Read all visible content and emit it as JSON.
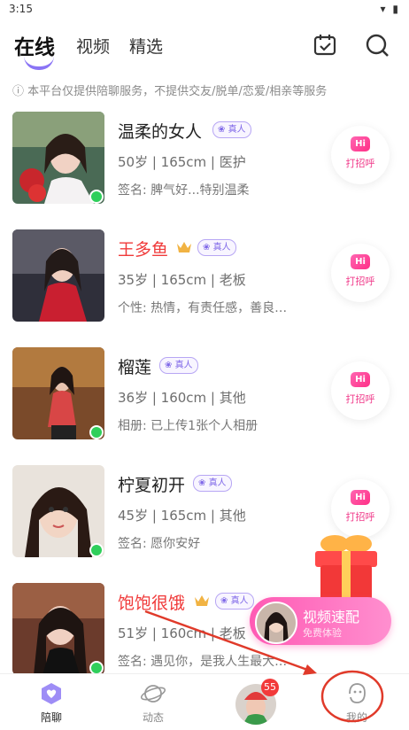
{
  "status": {
    "time": "3:15",
    "icons": "▾ ▮"
  },
  "topnav": {
    "tabs": [
      {
        "label": "在线",
        "active": true
      },
      {
        "label": "视频",
        "active": false
      },
      {
        "label": "精选",
        "active": false
      }
    ],
    "actions": [
      "calendar-check-icon",
      "search-icon"
    ]
  },
  "notice": "ⓘ 本平台仅提供陪聊服务，不提供交友/脱单/恋爱/相亲等服务",
  "real_badge": "真人",
  "greet_label": "打招呼",
  "greet_hi": "Hi",
  "users": [
    {
      "name": "温柔的女人",
      "vip": false,
      "info": "50岁 | 165cm | 医护",
      "sig": "签名: 脾气好...特别温柔",
      "online": true
    },
    {
      "name": "王多鱼",
      "vip": true,
      "info": "35岁 | 165cm | 老板",
      "sig": "个性: 热情，有责任感，善良…",
      "online": false
    },
    {
      "name": "榴莲",
      "vip": false,
      "info": "36岁 | 160cm | 其他",
      "sig": "相册: 已上传1张个人相册",
      "online": true
    },
    {
      "name": "柠夏初开",
      "vip": false,
      "info": "45岁 | 165cm | 其他",
      "sig": "签名: 愿你安好",
      "online": true
    },
    {
      "name": "饱饱很饿",
      "vip": true,
      "info": "51岁 | 160cm | 老板",
      "sig": "签名: 遇见你，是我人生最大…",
      "online": true
    }
  ],
  "match_promo": {
    "title": "视频速配",
    "subtitle": "免费体验"
  },
  "tabbar": {
    "items": [
      {
        "label": "陪聊",
        "active": true
      },
      {
        "label": "动态",
        "active": false
      },
      {
        "label": "我的",
        "active": false
      }
    ],
    "message_badge": "55"
  },
  "colors": {
    "accent": "#8a74f5",
    "vip_name": "#f03a3a",
    "online": "#2fcf5b",
    "promo": "#ff5ab4"
  }
}
